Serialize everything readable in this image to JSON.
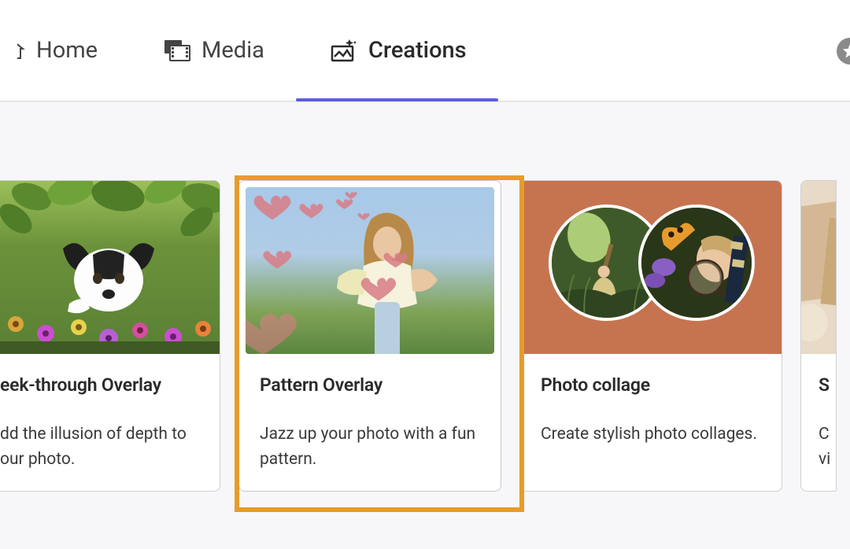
{
  "nav": {
    "home": "Home",
    "media": "Media",
    "creations": "Creations"
  },
  "cards": [
    {
      "title": "eek-through Overlay",
      "desc": "dd the illusion of depth to our photo."
    },
    {
      "title": "Pattern Overlay",
      "desc": "Jazz up your photo with a fun pattern."
    },
    {
      "title": "Photo collage",
      "desc": "Create stylish photo collages."
    },
    {
      "title": "S",
      "desc": "C vi"
    }
  ],
  "colors": {
    "accent": "#5c5ce0",
    "selection": "#e89b2d",
    "collage_bg": "#c67450"
  }
}
